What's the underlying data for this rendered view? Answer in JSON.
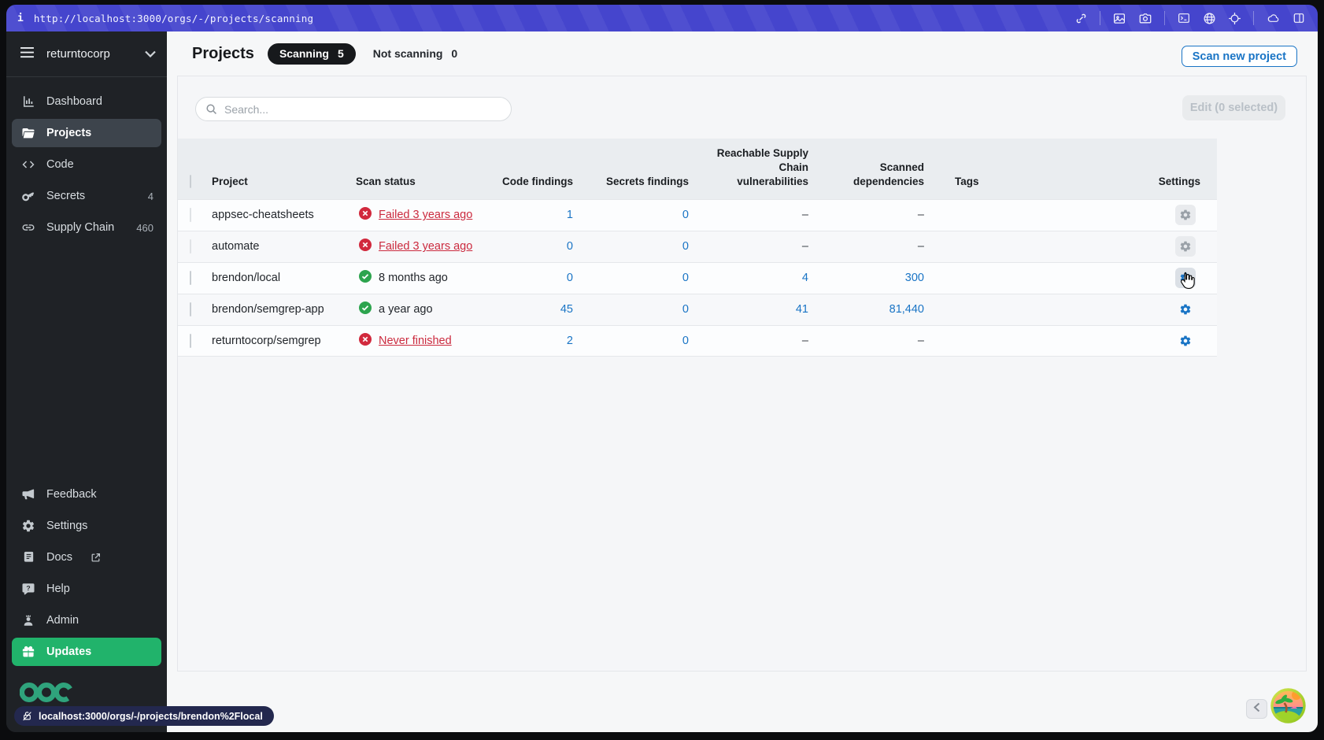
{
  "browser_bar": {
    "info_glyph": "i",
    "url": "http://localhost:3000/orgs/-/projects/scanning",
    "icons": [
      "link-icon",
      "image-icon",
      "camera-icon",
      "terminal-icon",
      "globe-icon",
      "crosshair-icon",
      "cloud-icon",
      "split-view-icon"
    ]
  },
  "sidebar": {
    "org": {
      "name": "returntocorp",
      "icons": [
        "hamburger-menu-icon",
        "chevron-down-icon"
      ]
    },
    "nav": [
      {
        "label": "Dashboard",
        "icon": "dashboard-chart-icon",
        "badge": "",
        "active": false
      },
      {
        "label": "Projects",
        "icon": "folder-icon",
        "badge": "",
        "active": true
      },
      {
        "label": "Code",
        "icon": "code-icon",
        "badge": "",
        "active": false
      },
      {
        "label": "Secrets",
        "icon": "key-icon",
        "badge": "4",
        "active": false
      },
      {
        "label": "Supply Chain",
        "icon": "chain-link-icon",
        "badge": "460",
        "active": false
      }
    ],
    "footer_nav": [
      {
        "label": "Feedback",
        "icon": "megaphone-icon"
      },
      {
        "label": "Settings",
        "icon": "gear-icon"
      },
      {
        "label": "Docs",
        "icon": "book-icon",
        "external": true
      },
      {
        "label": "Help",
        "icon": "help-bubble-icon"
      },
      {
        "label": "Admin",
        "icon": "admin-person-icon"
      },
      {
        "label": "Updates",
        "icon": "gift-icon",
        "highlighted": true
      }
    ],
    "logo": "semgrep-rings-logo",
    "status_tooltip": "localhost:3000/orgs/-/projects/brendon%2Flocal"
  },
  "header": {
    "title": "Projects",
    "tabs": [
      {
        "label": "Scanning",
        "count": "5",
        "active": true
      },
      {
        "label": "Not scanning",
        "count": "0",
        "active": false
      }
    ],
    "primary_action": "Scan new project"
  },
  "toolbar": {
    "search_placeholder": "Search...",
    "edit_button": "Edit (0 selected)"
  },
  "table": {
    "columns": [
      "Project",
      "Scan status",
      "Code findings",
      "Secrets findings",
      "Reachable Supply Chain vulnerabilities",
      "Scanned dependencies",
      "Tags",
      "Settings"
    ],
    "rows": [
      {
        "project": "appsec-cheatsheets",
        "status": "Failed 3 years ago",
        "status_kind": "failed",
        "code_findings": "1",
        "secrets_findings": "0",
        "reachable": "–",
        "scanned": "–",
        "tags": "",
        "gear_state": "muted"
      },
      {
        "project": "automate",
        "status": "Failed 3 years ago",
        "status_kind": "failed",
        "code_findings": "0",
        "secrets_findings": "0",
        "reachable": "–",
        "scanned": "–",
        "tags": "",
        "gear_state": "muted"
      },
      {
        "project": "brendon/local",
        "status": "8 months ago",
        "status_kind": "success",
        "code_findings": "0",
        "secrets_findings": "0",
        "reachable": "4",
        "scanned": "300",
        "tags": "",
        "gear_state": "hovered"
      },
      {
        "project": "brendon/semgrep-app",
        "status": "a year ago",
        "status_kind": "success",
        "code_findings": "45",
        "secrets_findings": "0",
        "reachable": "41",
        "scanned": "81,440",
        "tags": "",
        "gear_state": "normal"
      },
      {
        "project": "returntocorp/semgrep",
        "status": "Never finished",
        "status_kind": "failed",
        "code_findings": "2",
        "secrets_findings": "0",
        "reachable": "–",
        "scanned": "–",
        "tags": "",
        "gear_state": "normal"
      }
    ]
  },
  "footer": {
    "back_button_icon": "chevron-left-icon",
    "island_icon": "desert-island-icon"
  },
  "colors": {
    "urlbar_purple": "#4545cd",
    "sidebar_bg": "#1f2226",
    "accent_blue": "#1974c5",
    "failed_red": "#d1293d",
    "failed_text_red": "#cb2a3e",
    "success_green": "#2da44e",
    "updates_green": "#21b36b",
    "logo_green": "#2fa37c",
    "tooltip_bg": "#23284e",
    "active_item_bg": "#3d444c",
    "pill_dark": "#17191c"
  }
}
